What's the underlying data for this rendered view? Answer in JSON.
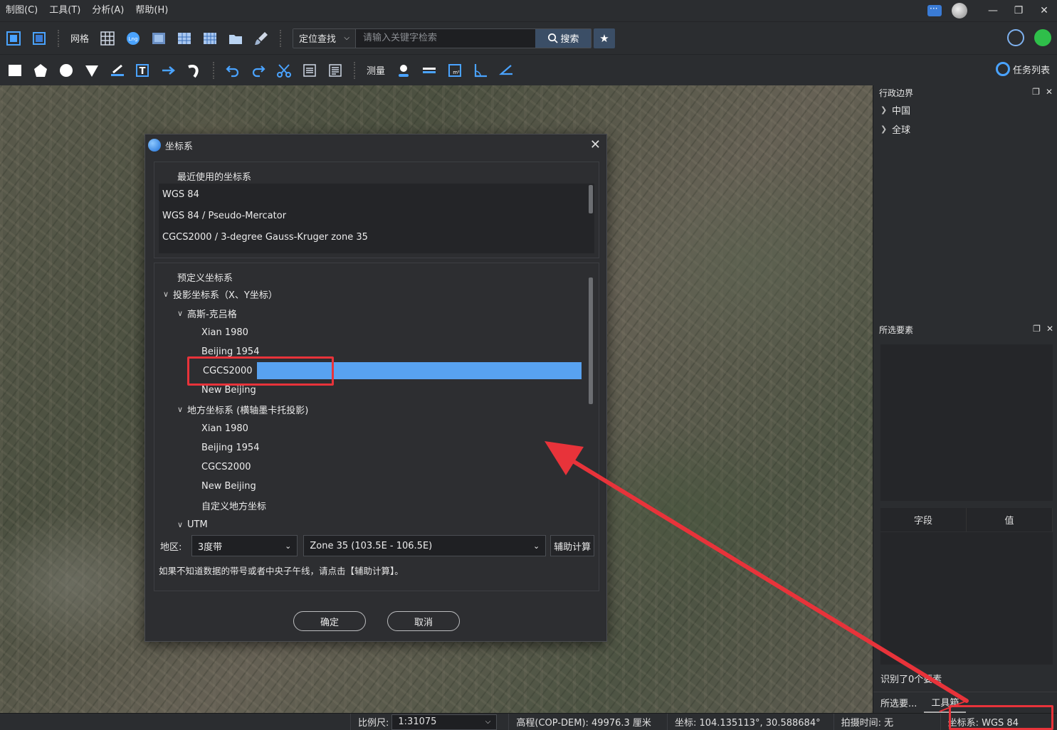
{
  "menu": [
    "制图(C)",
    "工具(T)",
    "分析(A)",
    "帮助(H)"
  ],
  "toolbar1": {
    "grid_label": "网格",
    "search_mode": "定位查找",
    "search_placeholder": "请输入关键字检索",
    "search_button": "搜索"
  },
  "toolbar2": {
    "measure_label": "测量",
    "task_list": "任务列表"
  },
  "right_panel": {
    "admin_title": "行政边界",
    "admin_items": [
      "中国",
      "全球"
    ],
    "selected_title": "所选要素",
    "field_col": "字段",
    "value_col": "值",
    "recognized": "识别了0个要素",
    "tabs": [
      "所选要...",
      "工具箱"
    ]
  },
  "dialog": {
    "title": "坐标系",
    "recent_title": "最近使用的坐标系",
    "recent_items": [
      "WGS 84",
      "WGS 84 / Pseudo-Mercator",
      "CGCS2000 / 3-degree Gauss-Kruger zone 35"
    ],
    "predefined_title": "预定义坐标系",
    "tree": [
      {
        "level": 0,
        "arrow": "expanded",
        "label": "投影坐标系（X、Y坐标）"
      },
      {
        "level": 1,
        "arrow": "expanded",
        "label": "高斯-克吕格"
      },
      {
        "level": 2,
        "arrow": "none",
        "label": "Xian 1980"
      },
      {
        "level": 2,
        "arrow": "none",
        "label": "Beijing 1954"
      },
      {
        "level": 2,
        "arrow": "none",
        "label": "CGCS2000",
        "selected": true
      },
      {
        "level": 2,
        "arrow": "none",
        "label": "New Beijing"
      },
      {
        "level": 1,
        "arrow": "expanded",
        "label": "地方坐标系 (横轴墨卡托投影)"
      },
      {
        "level": 2,
        "arrow": "none",
        "label": "Xian 1980"
      },
      {
        "level": 2,
        "arrow": "none",
        "label": "Beijing 1954"
      },
      {
        "level": 2,
        "arrow": "none",
        "label": "CGCS2000"
      },
      {
        "level": 2,
        "arrow": "none",
        "label": "New Beijing"
      },
      {
        "level": 2,
        "arrow": "none",
        "label": "自定义地方坐标"
      },
      {
        "level": 1,
        "arrow": "expanded",
        "label": "UTM"
      }
    ],
    "region_label": "地区:",
    "band_value": "3度带",
    "zone_value": "Zone 35 (103.5E - 106.5E)",
    "aux_button": "辅助计算",
    "hint": "如果不知道数据的带号或者中央子午线，请点击【辅助计算】。",
    "ok_button": "确定",
    "cancel_button": "取消"
  },
  "statusbar": {
    "scale_label": "比例尺:",
    "scale_value": "1:31075",
    "elevation": "高程(COP-DEM): 49976.3 厘米",
    "coords": "坐标: 104.135113°, 30.588684°",
    "capture_time": "拍摄时间: 无",
    "crs": "坐标系: WGS 84"
  },
  "colors": {
    "selection": "#58a2f0",
    "annotation": "#e8333a",
    "search_btn": "#3b4e66"
  }
}
